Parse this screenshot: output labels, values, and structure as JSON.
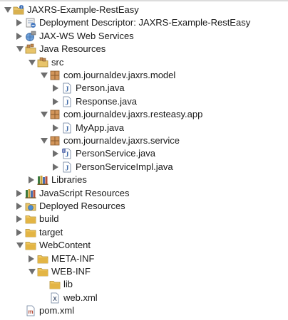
{
  "tree": [
    {
      "label": "JAXRS-Example-RestEasy",
      "icon": "project-icon",
      "depth": 0,
      "state": "expanded"
    },
    {
      "label": "Deployment Descriptor: JAXRS-Example-RestEasy",
      "icon": "deployment-descriptor-icon",
      "depth": 1,
      "state": "collapsed"
    },
    {
      "label": "JAX-WS Web Services",
      "icon": "web-services-icon",
      "depth": 1,
      "state": "collapsed"
    },
    {
      "label": "Java Resources",
      "icon": "java-resources-icon",
      "depth": 1,
      "state": "expanded"
    },
    {
      "label": "src",
      "icon": "source-folder-icon",
      "depth": 2,
      "state": "expanded"
    },
    {
      "label": "com.journaldev.jaxrs.model",
      "icon": "package-icon",
      "depth": 3,
      "state": "expanded"
    },
    {
      "label": "Person.java",
      "icon": "java-file-icon",
      "depth": 4,
      "state": "collapsed"
    },
    {
      "label": "Response.java",
      "icon": "java-file-icon",
      "depth": 4,
      "state": "collapsed"
    },
    {
      "label": "com.journaldev.jaxrs.resteasy.app",
      "icon": "package-icon",
      "depth": 3,
      "state": "expanded"
    },
    {
      "label": "MyApp.java",
      "icon": "java-file-icon",
      "depth": 4,
      "state": "collapsed"
    },
    {
      "label": "com.journaldev.jaxrs.service",
      "icon": "package-icon",
      "depth": 3,
      "state": "expanded"
    },
    {
      "label": "PersonService.java",
      "icon": "java-interface-file-icon",
      "depth": 4,
      "state": "collapsed"
    },
    {
      "label": "PersonServiceImpl.java",
      "icon": "java-file-icon",
      "depth": 4,
      "state": "collapsed"
    },
    {
      "label": "Libraries",
      "icon": "libraries-icon",
      "depth": 2,
      "state": "collapsed"
    },
    {
      "label": "JavaScript Resources",
      "icon": "javascript-resources-icon",
      "depth": 1,
      "state": "collapsed"
    },
    {
      "label": "Deployed Resources",
      "icon": "deployed-resources-icon",
      "depth": 1,
      "state": "collapsed"
    },
    {
      "label": "build",
      "icon": "folder-icon",
      "depth": 1,
      "state": "collapsed"
    },
    {
      "label": "target",
      "icon": "folder-icon",
      "depth": 1,
      "state": "collapsed"
    },
    {
      "label": "WebContent",
      "icon": "folder-icon",
      "depth": 1,
      "state": "expanded"
    },
    {
      "label": "META-INF",
      "icon": "folder-icon",
      "depth": 2,
      "state": "collapsed"
    },
    {
      "label": "WEB-INF",
      "icon": "folder-icon",
      "depth": 2,
      "state": "expanded"
    },
    {
      "label": "lib",
      "icon": "folder-icon",
      "depth": 3,
      "state": "leaf"
    },
    {
      "label": "web.xml",
      "icon": "xml-file-icon",
      "depth": 3,
      "state": "leaf"
    },
    {
      "label": "pom.xml",
      "icon": "maven-pom-icon",
      "depth": 1,
      "state": "leaf"
    }
  ]
}
